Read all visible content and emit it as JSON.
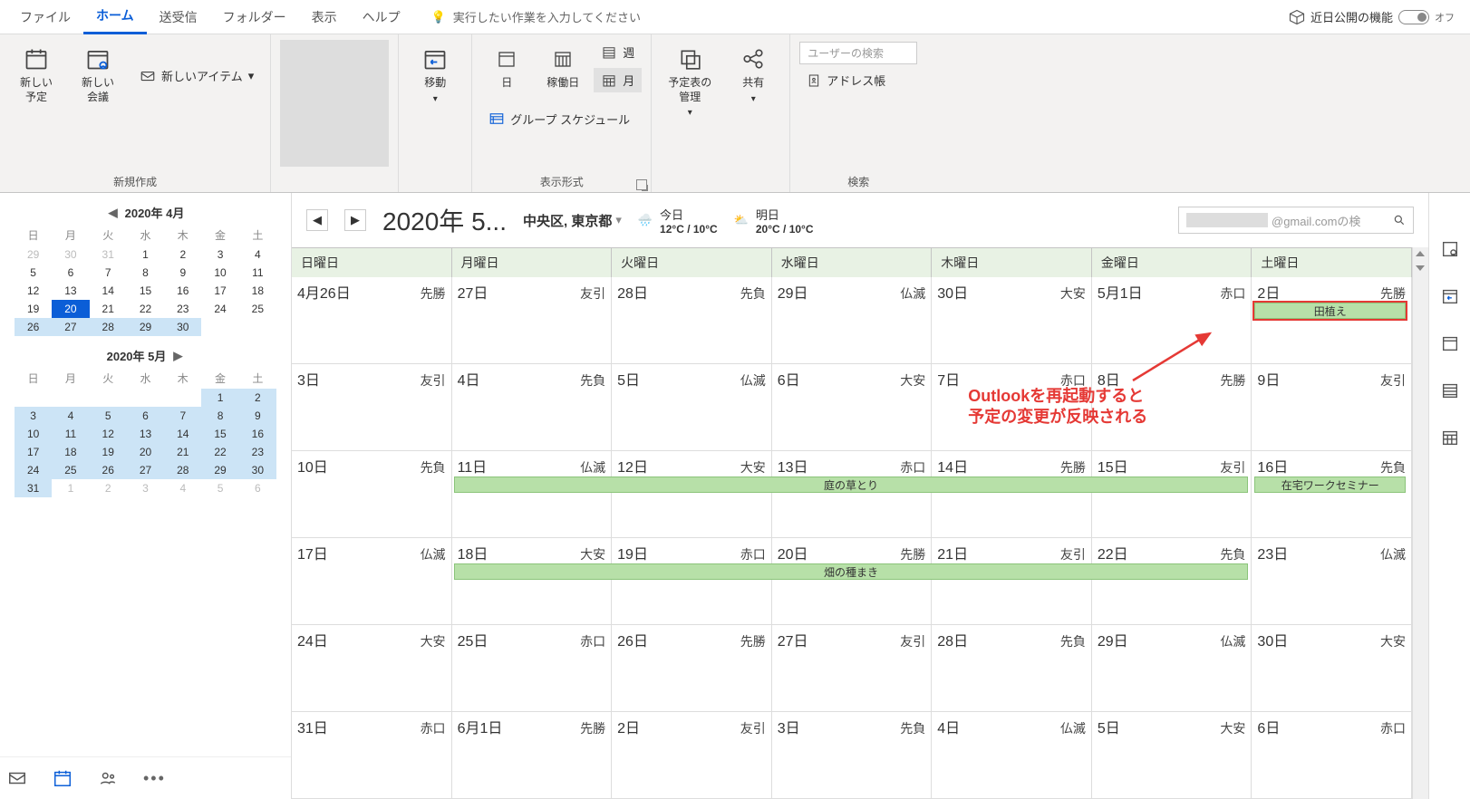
{
  "tabs": {
    "file": "ファイル",
    "home": "ホーム",
    "sendrecv": "送受信",
    "folder": "フォルダー",
    "view": "表示",
    "help": "ヘルプ",
    "tellme": "実行したい作業を入力してください",
    "coming": "近日公開の機能",
    "toggle": "オフ"
  },
  "ribbon": {
    "new_appt": "新しい\n予定",
    "new_mtg": "新しい\n会議",
    "new_item": "新しいアイテム",
    "grp_new": "新規作成",
    "move": "移動",
    "day": "日",
    "workday": "稼働日",
    "week": "週",
    "month": "月",
    "groupsched": "グループ スケジュール",
    "grp_arrange": "表示形式",
    "schedmgr": "予定表の\n管理",
    "share": "共有",
    "usersearch": "ユーザーの検索",
    "addrbook": "アドレス帳",
    "grp_search": "検索"
  },
  "sidebar": {
    "cal1": {
      "title": "2020年 4月",
      "dh": [
        "日",
        "月",
        "火",
        "水",
        "木",
        "金",
        "土"
      ],
      "cells": [
        [
          "29",
          "off"
        ],
        [
          "30",
          "off"
        ],
        [
          "31",
          "off"
        ],
        [
          "1",
          ""
        ],
        [
          "2",
          ""
        ],
        [
          "3",
          ""
        ],
        [
          "4",
          ""
        ],
        [
          "5",
          ""
        ],
        [
          "6",
          ""
        ],
        [
          "7",
          ""
        ],
        [
          "8",
          ""
        ],
        [
          "9",
          ""
        ],
        [
          "10",
          ""
        ],
        [
          "11",
          ""
        ],
        [
          "12",
          ""
        ],
        [
          "13",
          ""
        ],
        [
          "14",
          ""
        ],
        [
          "15",
          ""
        ],
        [
          "16",
          ""
        ],
        [
          "17",
          ""
        ],
        [
          "18",
          ""
        ],
        [
          "19",
          ""
        ],
        [
          "20",
          "today"
        ],
        [
          "21",
          ""
        ],
        [
          "22",
          ""
        ],
        [
          "23",
          ""
        ],
        [
          "24",
          ""
        ],
        [
          "25",
          ""
        ],
        [
          "26",
          "sel"
        ],
        [
          "27",
          "sel"
        ],
        [
          "28",
          "sel"
        ],
        [
          "29",
          "sel"
        ],
        [
          "30",
          "sel"
        ]
      ]
    },
    "cal2": {
      "title": "2020年 5月",
      "dh": [
        "日",
        "月",
        "火",
        "水",
        "木",
        "金",
        "土"
      ],
      "cells": [
        [
          "1",
          "sel"
        ],
        [
          "2",
          "sel"
        ],
        [
          "3",
          "sel"
        ],
        [
          "4",
          "sel"
        ],
        [
          "5",
          "sel"
        ],
        [
          "6",
          "sel"
        ],
        [
          "7",
          "sel"
        ],
        [
          "8",
          "sel"
        ],
        [
          "9",
          "sel"
        ],
        [
          "10",
          "sel"
        ],
        [
          "11",
          "sel"
        ],
        [
          "12",
          "sel"
        ],
        [
          "13",
          "sel"
        ],
        [
          "14",
          "sel"
        ],
        [
          "15",
          "sel"
        ],
        [
          "16",
          "sel"
        ],
        [
          "17",
          "sel"
        ],
        [
          "18",
          "sel"
        ],
        [
          "19",
          "sel"
        ],
        [
          "20",
          "sel"
        ],
        [
          "21",
          "sel"
        ],
        [
          "22",
          "sel"
        ],
        [
          "23",
          "sel"
        ],
        [
          "24",
          "sel"
        ],
        [
          "25",
          "sel"
        ],
        [
          "26",
          "sel"
        ],
        [
          "27",
          "sel"
        ],
        [
          "28",
          "sel"
        ],
        [
          "29",
          "sel"
        ],
        [
          "30",
          "sel"
        ],
        [
          "31",
          "sel"
        ],
        [
          "1",
          "off"
        ],
        [
          "2",
          "off"
        ],
        [
          "3",
          "off"
        ],
        [
          "4",
          "off"
        ],
        [
          "5",
          "off"
        ],
        [
          "6",
          "off"
        ]
      ],
      "pad": 5
    }
  },
  "calhead": {
    "title": "2020年 5...",
    "location": "中央区, 東京都",
    "today_lbl": "今日",
    "today_temp": "12°C / 10°C",
    "tom_lbl": "明日",
    "tom_temp": "20°C / 10°C",
    "search": "@gmail.comの検"
  },
  "dow": [
    "日曜日",
    "月曜日",
    "火曜日",
    "水曜日",
    "木曜日",
    "金曜日",
    "土曜日"
  ],
  "weeks": [
    [
      [
        "4月26日",
        "先勝"
      ],
      [
        "27日",
        "友引"
      ],
      [
        "28日",
        "先負"
      ],
      [
        "29日",
        "仏滅"
      ],
      [
        "30日",
        "大安"
      ],
      [
        "5月1日",
        "赤口"
      ],
      [
        "2日",
        "先勝"
      ]
    ],
    [
      [
        "3日",
        "友引"
      ],
      [
        "4日",
        "先負"
      ],
      [
        "5日",
        "仏滅"
      ],
      [
        "6日",
        "大安"
      ],
      [
        "7日",
        "赤口"
      ],
      [
        "8日",
        "先勝"
      ],
      [
        "9日",
        "友引"
      ]
    ],
    [
      [
        "10日",
        "先負"
      ],
      [
        "11日",
        "仏滅"
      ],
      [
        "12日",
        "大安"
      ],
      [
        "13日",
        "赤口"
      ],
      [
        "14日",
        "先勝"
      ],
      [
        "15日",
        "友引"
      ],
      [
        "16日",
        "先負"
      ]
    ],
    [
      [
        "17日",
        "仏滅"
      ],
      [
        "18日",
        "大安"
      ],
      [
        "19日",
        "赤口"
      ],
      [
        "20日",
        "先勝"
      ],
      [
        "21日",
        "友引"
      ],
      [
        "22日",
        "先負"
      ],
      [
        "23日",
        "仏滅"
      ]
    ],
    [
      [
        "24日",
        "大安"
      ],
      [
        "25日",
        "赤口"
      ],
      [
        "26日",
        "先勝"
      ],
      [
        "27日",
        "友引"
      ],
      [
        "28日",
        "先負"
      ],
      [
        "29日",
        "仏滅"
      ],
      [
        "30日",
        "大安"
      ]
    ],
    [
      [
        "31日",
        "赤口"
      ],
      [
        "6月1日",
        "先勝"
      ],
      [
        "2日",
        "友引"
      ],
      [
        "3日",
        "先負"
      ],
      [
        "4日",
        "仏滅"
      ],
      [
        "5日",
        "大安"
      ],
      [
        "6日",
        "赤口"
      ]
    ]
  ],
  "events": {
    "taue": "田植え",
    "niwa": "庭の草とり",
    "zaitaku": "在宅ワークセミナー",
    "hatake": "畑の種まき"
  },
  "annotation": {
    "l1": "Outlookを再起動すると",
    "l2": "予定の変更が反映される"
  }
}
